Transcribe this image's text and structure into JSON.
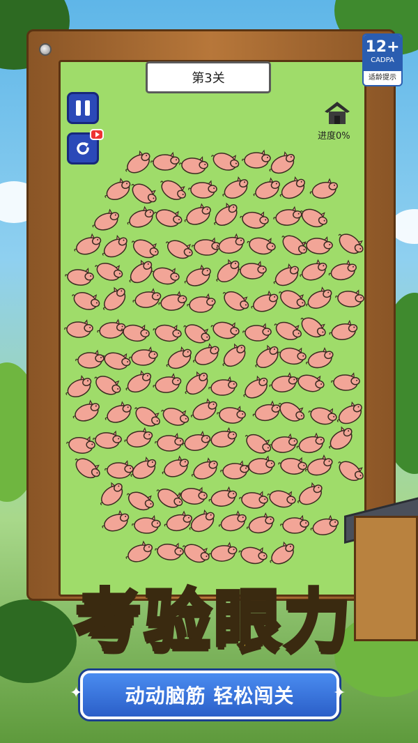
{
  "level": {
    "label": "第3关"
  },
  "progress": {
    "label": "进度0%",
    "value_percent": 0
  },
  "age_rating": {
    "age": "12+",
    "org": "CADPA",
    "tip": "适龄提示"
  },
  "controls": {
    "pause_icon": "pause-icon",
    "replay_icon": "replay-video-icon"
  },
  "title": {
    "chars": [
      "考",
      "验",
      "眼",
      "力"
    ]
  },
  "subtitle": "动动脑筋 轻松闯关",
  "colors": {
    "board": "#9fdc6a",
    "pig": "#f2a597",
    "frame": "#b7773a",
    "button": "#2b49b8",
    "title_green": "#9be34a",
    "title_yellow": "#ffd436",
    "ribbon": "#2b5fc8"
  }
}
